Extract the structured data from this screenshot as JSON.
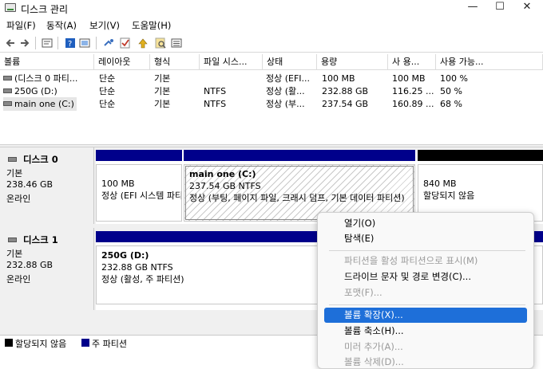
{
  "window": {
    "title": "디스크 관리"
  },
  "menu": [
    "파일(F)",
    "동작(A)",
    "보기(V)",
    "도움말(H)"
  ],
  "columns": [
    "볼륨",
    "레이아웃",
    "형식",
    "파일 시스...",
    "상태",
    "용량",
    "사 용...",
    "사용 가능..."
  ],
  "volumes": [
    [
      "(디스크 0 파티...",
      "단순",
      "기본",
      "",
      "정상 (EFI...",
      "100 MB",
      "100 MB",
      "100 %"
    ],
    [
      "250G (D:)",
      "단순",
      "기본",
      "NTFS",
      "정상 (활...",
      "232.88 GB",
      "116.25 ...",
      "50 %"
    ],
    [
      "main one (C:)",
      "단순",
      "기본",
      "NTFS",
      "정상 (부...",
      "237.54 GB",
      "160.89 ...",
      "68 %"
    ]
  ],
  "disk0": {
    "name": "디스크 0",
    "type": "기본",
    "size": "238.46 GB",
    "status": "온라인",
    "p1": {
      "line1": "100 MB",
      "line2": "정상 (EFI 시스템 파티션)"
    },
    "p2": {
      "title": "main one  (C:)",
      "line1": "237.54 GB NTFS",
      "line2": "정상 (부팅, 페이지 파일, 크래시 덤프, 기본 데이터 파티션)"
    },
    "p3": {
      "line1": "840 MB",
      "line2": "할당되지 않음"
    }
  },
  "disk1": {
    "name": "디스크 1",
    "type": "기본",
    "size": "232.88 GB",
    "status": "온라인",
    "p1": {
      "title": "250G  (D:)",
      "line1": "232.88 GB NTFS",
      "line2": "정상 (활성, 주 파티션)"
    }
  },
  "legend": {
    "unallocated": "할당되지 않음",
    "primary": "주 파티션"
  },
  "context_menu": [
    {
      "label": "열기(O)",
      "disabled": false
    },
    {
      "label": "탐색(E)",
      "disabled": false
    },
    {
      "sep": true
    },
    {
      "label": "파티션을 활성 파티션으로 표시(M)",
      "disabled": true
    },
    {
      "label": "드라이브 문자 및 경로 변경(C)...",
      "disabled": false
    },
    {
      "label": "포맷(F)...",
      "disabled": true
    },
    {
      "sep": true
    },
    {
      "label": "볼륨 확장(X)...",
      "disabled": false,
      "highlighted": true
    },
    {
      "label": "볼륨 축소(H)...",
      "disabled": false
    },
    {
      "label": "미러 추가(A)...",
      "disabled": true
    },
    {
      "label": "볼륨 삭제(D)...",
      "disabled": true
    }
  ],
  "colors": {
    "primary_partition": "#00008b",
    "unallocated": "#000000",
    "highlight": "#1e6fd9"
  },
  "icons": [
    "back-icon",
    "forward-icon",
    "properties-icon",
    "help-icon",
    "console-icon",
    "connect-icon",
    "check-icon",
    "up-icon",
    "search-icon",
    "list-icon"
  ]
}
